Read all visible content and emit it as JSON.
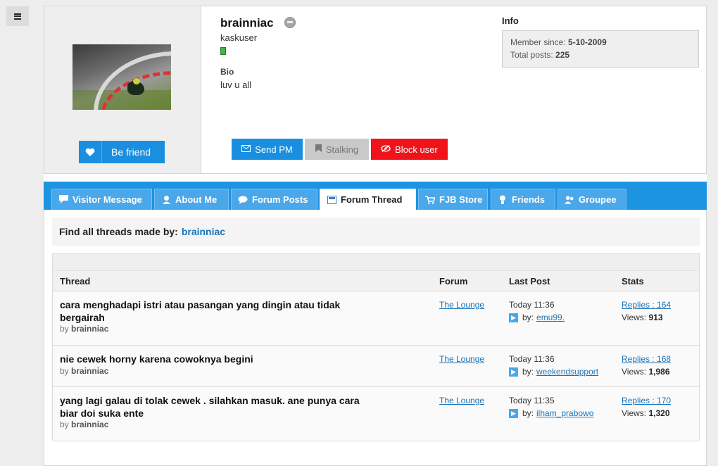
{
  "profile": {
    "username": "brainniac",
    "rank": "kaskuser",
    "bio_heading": "Bio",
    "bio_text": "luv u all",
    "befriend_label": "Be friend",
    "buttons": {
      "send_pm": "Send PM",
      "stalking": "Stalking",
      "block_user": "Block user"
    },
    "info": {
      "heading": "Info",
      "member_since_label": "Member since:",
      "member_since_value": "5-10-2009",
      "total_posts_label": "Total posts:",
      "total_posts_value": "225"
    }
  },
  "tabs": [
    {
      "label": "Visitor Message",
      "icon": "message-icon"
    },
    {
      "label": "About Me",
      "icon": "user-icon"
    },
    {
      "label": "Forum Posts",
      "icon": "chat-icon"
    },
    {
      "label": "Forum Thread",
      "icon": "calendar-icon",
      "active": true
    },
    {
      "label": "FJB Store",
      "icon": "cart-icon"
    },
    {
      "label": "Friends",
      "icon": "friend-icon"
    },
    {
      "label": "Groupee",
      "icon": "group-icon"
    }
  ],
  "find": {
    "label": "Find all threads made by:",
    "user": "brainniac"
  },
  "table": {
    "headers": {
      "thread": "Thread",
      "forum": "Forum",
      "last_post": "Last Post",
      "stats": "Stats"
    },
    "rows": [
      {
        "title": "cara menghadapi istri atau pasangan yang dingin atau tidak bergairah",
        "by_label": "by",
        "by_user": "brainniac",
        "forum": "The Lounge",
        "last_time": "Today 11:36",
        "last_by_label": "by:",
        "last_user": "emu99.",
        "replies": "Replies : 164",
        "views_label": "Views:",
        "views": "913"
      },
      {
        "title": "nie cewek horny karena cowoknya begini",
        "by_label": "by",
        "by_user": "brainniac",
        "forum": "The Lounge",
        "last_time": "Today 11:36",
        "last_by_label": "by:",
        "last_user": "weekendsupport",
        "replies": "Replies : 168",
        "views_label": "Views:",
        "views": "1,986"
      },
      {
        "title": "yang lagi galau di tolak cewek . silahkan masuk. ane punya cara biar doi suka ente",
        "by_label": "by",
        "by_user": "brainniac",
        "forum": "The Lounge",
        "last_time": "Today 11:35",
        "last_by_label": "by:",
        "last_user": "ilham_prabowo",
        "replies": "Replies : 170",
        "views_label": "Views:",
        "views": "1,320"
      }
    ]
  },
  "colors": {
    "accent": "#1c94e2",
    "danger": "#f0141a",
    "link": "#1a73b8",
    "online": "#44b443"
  }
}
